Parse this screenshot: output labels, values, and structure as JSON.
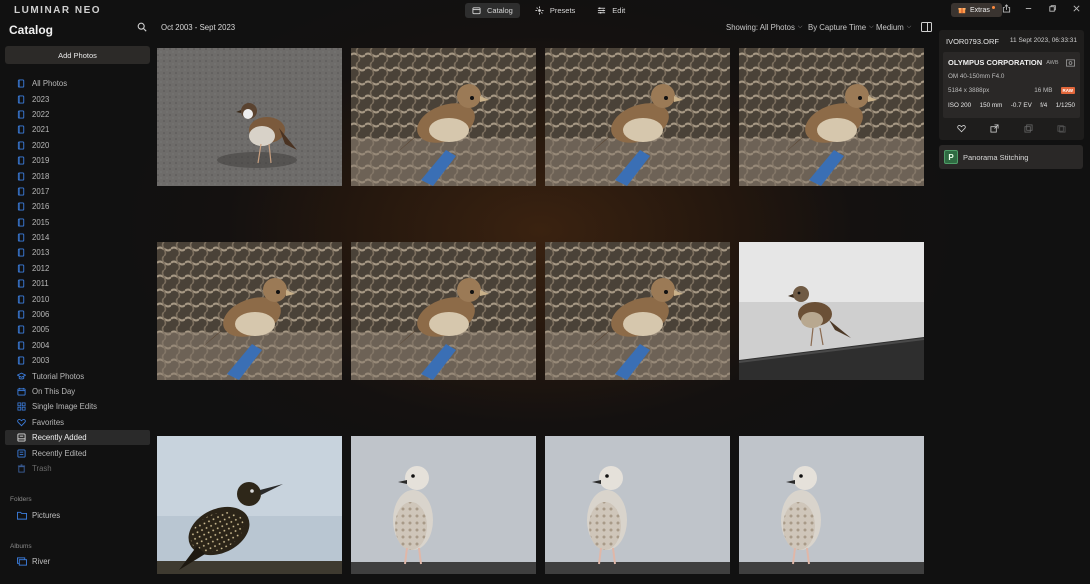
{
  "app": {
    "logo": "LUMINAR NEO"
  },
  "modes": [
    {
      "label": "Catalog",
      "icon": "catalog-icon",
      "active": true
    },
    {
      "label": "Presets",
      "icon": "presets-icon",
      "active": false
    },
    {
      "label": "Edit",
      "icon": "edit-icon",
      "active": false
    }
  ],
  "extras": {
    "label": "Extras"
  },
  "sidebar": {
    "title": "Catalog",
    "add_photos": "Add Photos",
    "items": [
      {
        "label": "All Photos",
        "icon": "photos-icon"
      },
      {
        "label": "2023",
        "icon": "year-folder-icon"
      },
      {
        "label": "2022",
        "icon": "year-folder-icon"
      },
      {
        "label": "2021",
        "icon": "year-folder-icon"
      },
      {
        "label": "2020",
        "icon": "year-folder-icon"
      },
      {
        "label": "2019",
        "icon": "year-folder-icon"
      },
      {
        "label": "2018",
        "icon": "year-folder-icon"
      },
      {
        "label": "2017",
        "icon": "year-folder-icon"
      },
      {
        "label": "2016",
        "icon": "year-folder-icon"
      },
      {
        "label": "2015",
        "icon": "year-folder-icon"
      },
      {
        "label": "2014",
        "icon": "year-folder-icon"
      },
      {
        "label": "2013",
        "icon": "year-folder-icon"
      },
      {
        "label": "2012",
        "icon": "year-folder-icon"
      },
      {
        "label": "2011",
        "icon": "year-folder-icon"
      },
      {
        "label": "2010",
        "icon": "year-folder-icon"
      },
      {
        "label": "2006",
        "icon": "year-folder-icon"
      },
      {
        "label": "2005",
        "icon": "year-folder-icon"
      },
      {
        "label": "2004",
        "icon": "year-folder-icon"
      },
      {
        "label": "2003",
        "icon": "year-folder-icon"
      },
      {
        "label": "Tutorial Photos",
        "icon": "graduation-cap-icon"
      },
      {
        "label": "On This Day",
        "icon": "calendar-icon"
      },
      {
        "label": "Single Image Edits",
        "icon": "grid-icon"
      },
      {
        "label": "Favorites",
        "icon": "heart-icon"
      },
      {
        "label": "Recently Added",
        "icon": "recently-added-icon",
        "active": true
      },
      {
        "label": "Recently Edited",
        "icon": "recently-edited-icon"
      },
      {
        "label": "Trash",
        "icon": "trash-icon",
        "dim": true
      }
    ],
    "folders_label": "Folders",
    "folders": [
      {
        "label": "Pictures",
        "icon": "folder-icon"
      }
    ],
    "albums_label": "Albums",
    "albums": [
      {
        "label": "River",
        "icon": "album-icon"
      }
    ]
  },
  "header": {
    "date_range": "Oct 2003 - Sept 2023",
    "showing": "Showing: All Photos",
    "sort": "By Capture Time",
    "size": "Medium"
  },
  "photos": [
    {
      "subject": "sparrow-ground"
    },
    {
      "subject": "sparrow-nets"
    },
    {
      "subject": "sparrow-nets"
    },
    {
      "subject": "sparrow-nets"
    },
    {
      "subject": "sparrow-nets"
    },
    {
      "subject": "sparrow-nets"
    },
    {
      "subject": "sparrow-nets"
    },
    {
      "subject": "sparrow-roof"
    },
    {
      "subject": "starling"
    },
    {
      "subject": "gull"
    },
    {
      "subject": "gull"
    },
    {
      "subject": "gull"
    }
  ],
  "info": {
    "filename": "IVOR0793.ORF",
    "datetime": "11 Sept 2023, 06:33:31",
    "camera": "OLYMPUS CORPORATION",
    "awb": "AWB",
    "lens": "OM 40-150mm F4.0",
    "dimensions": "5184 x 3888px",
    "filesize": "16 MB",
    "raw_badge": "RAW",
    "iso": "ISO 200",
    "focal": "150 mm",
    "ev": "-0.7 EV",
    "aperture": "f/4",
    "shutter": "1/1250"
  },
  "extensions": {
    "panorama": "Panorama Stitching",
    "badge": "P"
  },
  "colors": {
    "accent": "#3b7ddd",
    "raw": "#e1663a",
    "pano": "#2f6b42"
  }
}
